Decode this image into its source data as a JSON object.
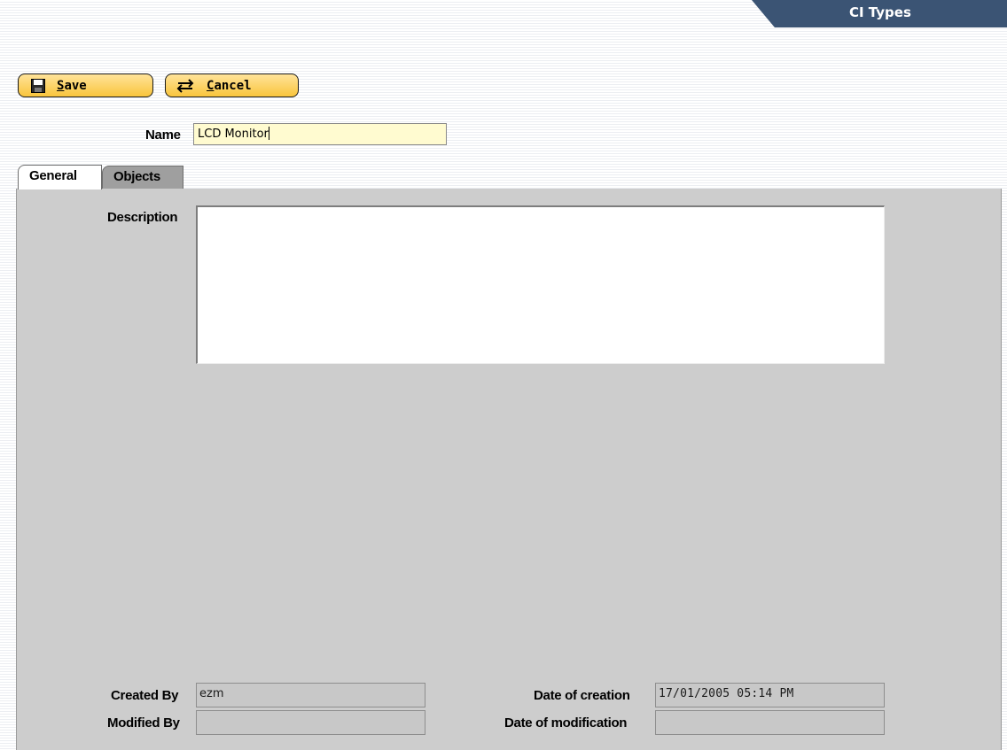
{
  "header": {
    "title": "CI Types"
  },
  "toolbar": {
    "save_label": "Save",
    "cancel_label": "Cancel"
  },
  "form": {
    "name_label": "Name",
    "name_value": "LCD Monitor"
  },
  "tabs": [
    {
      "label": "General",
      "active": true
    },
    {
      "label": "Objects",
      "active": false
    }
  ],
  "general": {
    "description_label": "Description",
    "description_value": "",
    "created_by_label": "Created By",
    "created_by_value": "ezm",
    "modified_by_label": "Modified By",
    "modified_by_value": "",
    "date_creation_label": "Date of creation",
    "date_creation_value": "17/01/2005 05:14 PM",
    "date_modification_label": "Date of modification",
    "date_modification_value": ""
  },
  "icons": {
    "save": "floppy-disk-icon",
    "cancel": "swap-arrows-icon"
  },
  "colors": {
    "header_bg": "#3b5474",
    "button_bg": "#f9c53c",
    "name_input_bg": "#fffbd0",
    "panel_bg": "#cdcdcd",
    "inactive_tab_bg": "#9f9f9f"
  }
}
